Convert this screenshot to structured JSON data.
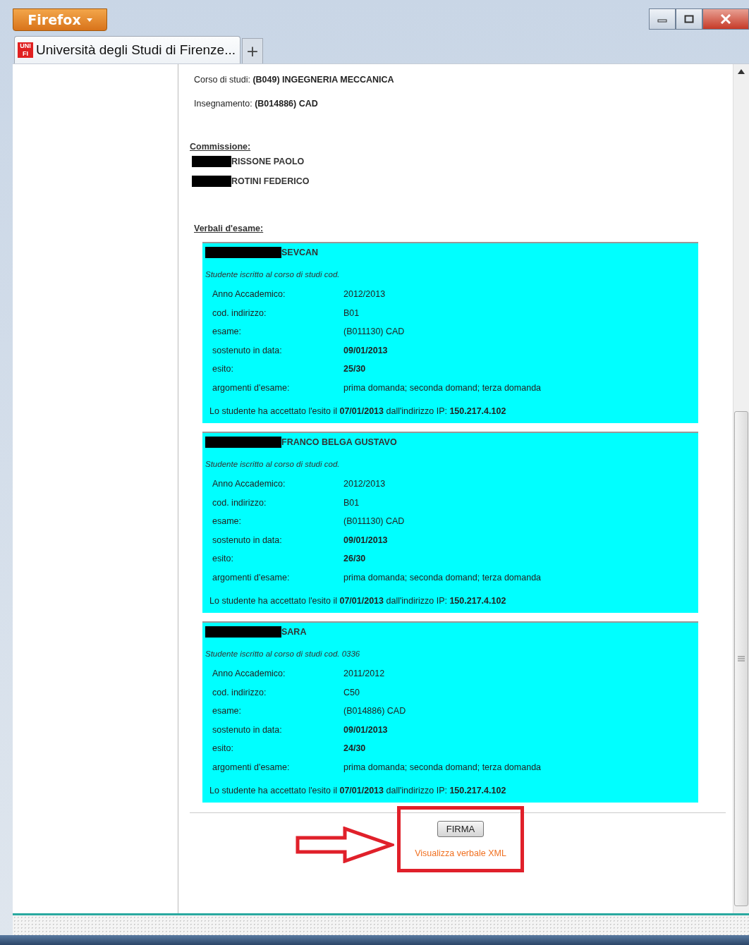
{
  "browser": {
    "menu_button": "Firefox",
    "tab": {
      "title": "Università degli Studi di Firenze...",
      "favicon": "UNI FI",
      "selected": true
    },
    "new_tab": "+"
  },
  "header": [
    {
      "text": "Corso di studi: **(B049) INGEGNERIA MECCANICA**"
    },
    {
      "text": "Insegnamento: **(B014886) CAD**"
    }
  ],
  "commission": {
    "title": "Commissione:",
    "members": [
      "RISSONE PAOLO",
      "ROTINI FEDERICO"
    ]
  },
  "verbali": {
    "title": "Verbali d'esame:",
    "records": [
      {
        "student": "SEVCAN",
        "enrollment": "Studente iscritto al corso di studi cod.",
        "fields": [
          {
            "label": "Anno Accademico:",
            "value": "2012/2013",
            "bold": false
          },
          {
            "label": "cod. indirizzo:",
            "value": "B01",
            "bold": false
          },
          {
            "label": "esame:",
            "value": "(B011130) CAD",
            "bold": false
          },
          {
            "label": "sostenuto in data:",
            "value": "09/01/2013",
            "bold": true
          },
          {
            "label": "esito:",
            "value": "25/30",
            "bold": true
          },
          {
            "label": "argomenti d'esame:",
            "value": "prima domanda; seconda domand; terza domanda",
            "bold": false
          }
        ],
        "accepted": "Lo studente ha accettato l'esito il **07/01/2013** dall'indirizzo IP: **150.217.4.102**"
      },
      {
        "student": "FRANCO BELGA GUSTAVO",
        "enrollment": "Studente iscritto al corso di studi cod.",
        "fields": [
          {
            "label": "Anno Accademico:",
            "value": "2012/2013",
            "bold": false
          },
          {
            "label": "cod. indirizzo:",
            "value": "B01",
            "bold": false
          },
          {
            "label": "esame:",
            "value": "(B011130) CAD",
            "bold": false
          },
          {
            "label": "sostenuto in data:",
            "value": "09/01/2013",
            "bold": true
          },
          {
            "label": "esito:",
            "value": "26/30",
            "bold": true
          },
          {
            "label": "argomenti d'esame:",
            "value": "prima domanda; seconda domand; terza domanda",
            "bold": false
          }
        ],
        "accepted": "Lo studente ha accettato l'esito il **07/01/2013** dall'indirizzo IP: **150.217.4.102**"
      },
      {
        "student": "SARA",
        "enrollment": "Studente iscritto al corso di studi cod. 0336",
        "fields": [
          {
            "label": "Anno Accademico:",
            "value": "2011/2012",
            "bold": false
          },
          {
            "label": "cod. indirizzo:",
            "value": "C50",
            "bold": false
          },
          {
            "label": "esame:",
            "value": "(B014886) CAD",
            "bold": false
          },
          {
            "label": "sostenuto in data:",
            "value": "09/01/2013",
            "bold": true
          },
          {
            "label": "esito:",
            "value": "24/30",
            "bold": true
          },
          {
            "label": "argomenti d'esame:",
            "value": "prima domanda; seconda domand; terza domanda",
            "bold": false
          }
        ],
        "accepted": "Lo studente ha accettato l'esito il **07/01/2013** dall'indirizzo IP: **150.217.4.102**"
      }
    ]
  },
  "actions": {
    "sign_button": "FIRMA",
    "xml_link": "Visualizza verbale XML"
  }
}
